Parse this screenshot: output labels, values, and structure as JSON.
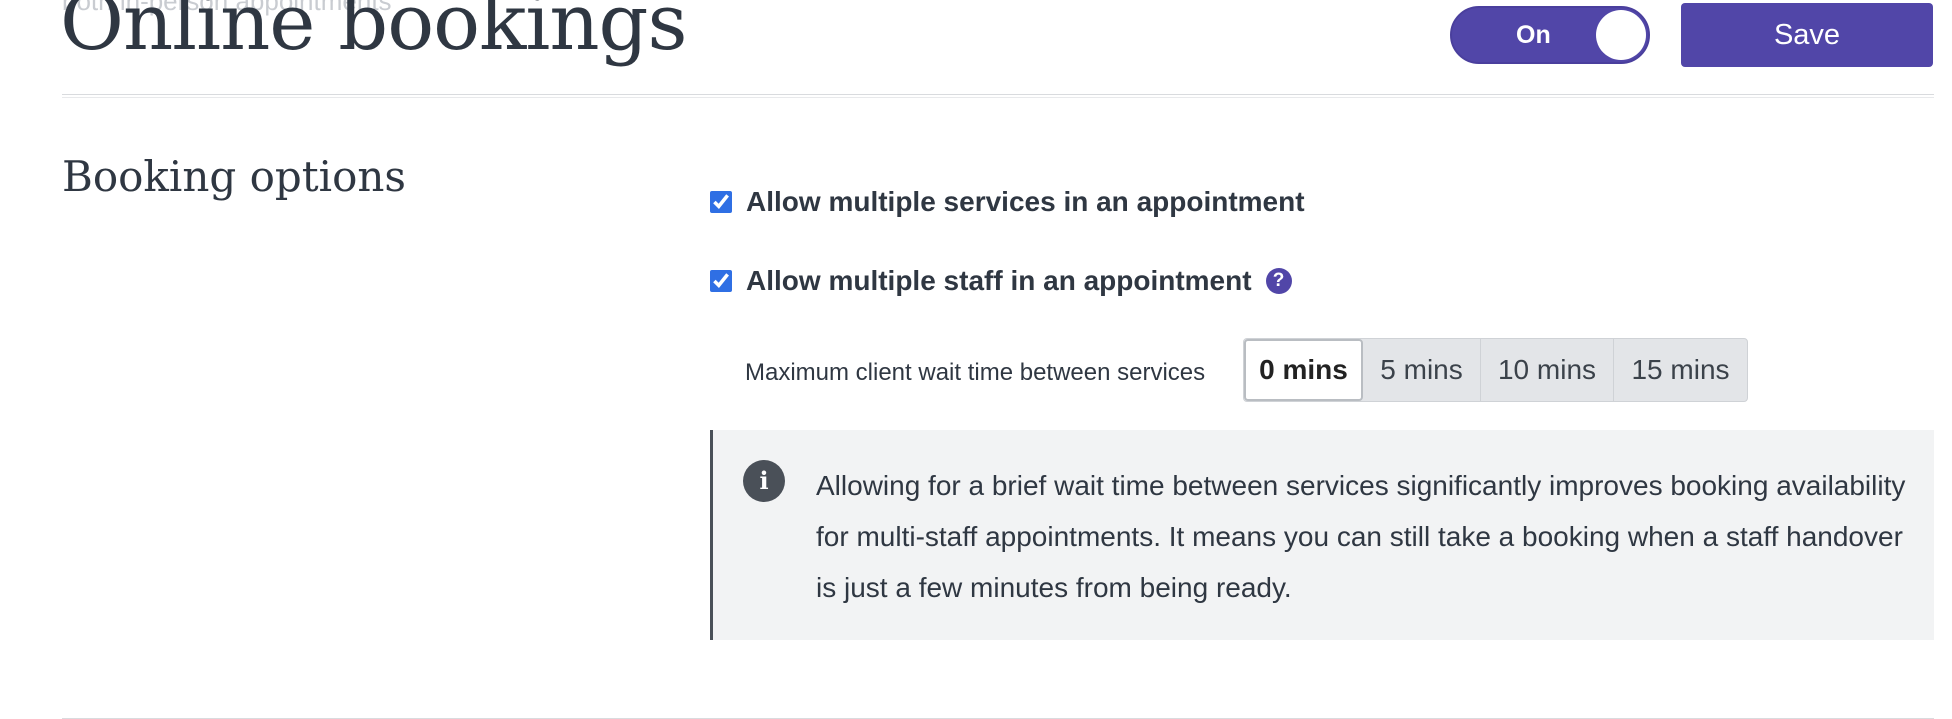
{
  "header": {
    "faded_text": "both in-person appointments",
    "title": "Online bookings",
    "toggle_label": "On",
    "save_label": "Save"
  },
  "section": {
    "title": "Booking options"
  },
  "options": {
    "multiple_services": {
      "label": "Allow multiple services in an appointment",
      "checked": true
    },
    "multiple_staff": {
      "label": "Allow multiple staff in an appointment",
      "checked": true,
      "help_icon": "question-icon"
    }
  },
  "wait_time": {
    "label": "Maximum client wait time between services",
    "options": [
      "0 mins",
      "5 mins",
      "10 mins",
      "15 mins"
    ],
    "selected": "0 mins"
  },
  "info": {
    "icon": "info-icon",
    "text": "Allowing for a brief wait time between services significantly improves booking availability for multi-staff appointments. It means you can still take a booking when a staff handover is just a few minutes from being ready."
  },
  "colors": {
    "accent": "#5146a8",
    "text": "#2f3742",
    "info_bg": "#f2f3f4",
    "checkbox": "#2f6fe4"
  }
}
